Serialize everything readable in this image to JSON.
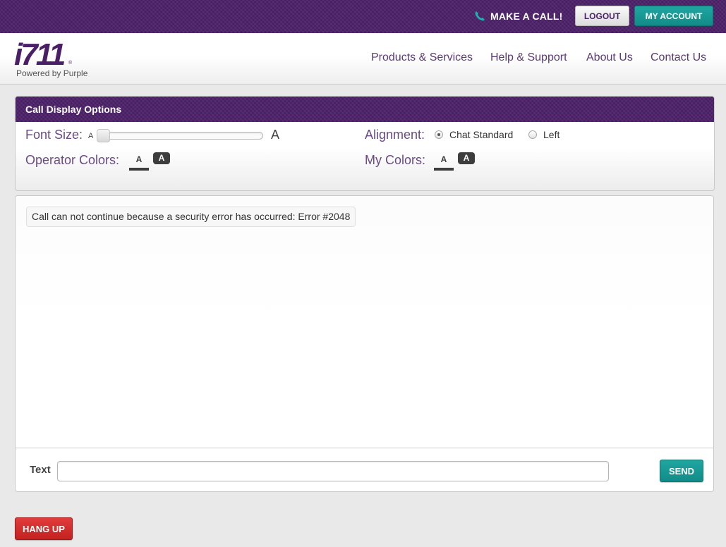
{
  "topbar": {
    "make_call_label": "MAKE A CALL!",
    "logout_label": "LOGOUT",
    "account_label": "MY ACCOUNT"
  },
  "header": {
    "logo_mark": "i711",
    "logo_reg": "®",
    "logo_tagline": "Powered by Purple",
    "nav": [
      "Products & Services",
      "Help & Support",
      "About Us",
      "Contact Us"
    ]
  },
  "options": {
    "title": "Call Display Options",
    "font_size_label": "Font Size:",
    "font_small_glyph": "A",
    "font_large_glyph": "A",
    "font_size_value": 0,
    "operator_colors_label": "Operator Colors:",
    "my_colors_label": "My Colors:",
    "swatch_glyph": "A",
    "alignment_label": "Alignment:",
    "alignment_options": [
      "Chat Standard",
      "Left"
    ],
    "alignment_selected": "Chat Standard"
  },
  "chat": {
    "messages": [
      "Call can not continue because a security error has occurred: Error #2048"
    ],
    "text_label": "Text",
    "text_value": "",
    "send_label": "SEND"
  },
  "hangup_label": "HANG UP",
  "colors": {
    "brand_purple": "#4b1f68",
    "teal": "#1a9c97",
    "danger_red": "#d22f2f",
    "nav_text": "#5b3a75"
  }
}
